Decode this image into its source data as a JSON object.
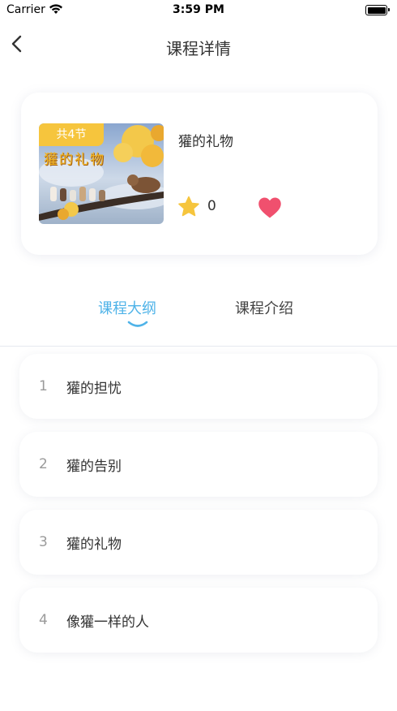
{
  "status_bar": {
    "carrier": "Carrier",
    "time": "3:59 PM"
  },
  "nav": {
    "title": "课程详情",
    "back_icon": "chevron-left-icon"
  },
  "course": {
    "badge": "共4节",
    "cover_title": "獾的礼物",
    "title": "獾的礼物",
    "star_count": "0",
    "favorite_color": "#f0506e",
    "star_color": "#f6c53d"
  },
  "tabs": [
    {
      "label": "课程大纲",
      "active": true
    },
    {
      "label": "课程介绍",
      "active": false
    }
  ],
  "accent_color": "#4fb3e8",
  "chapters": [
    {
      "num": "1",
      "title": "獾的担忧"
    },
    {
      "num": "2",
      "title": "獾的告别"
    },
    {
      "num": "3",
      "title": "獾的礼物"
    },
    {
      "num": "4",
      "title": "像獾一样的人"
    }
  ]
}
